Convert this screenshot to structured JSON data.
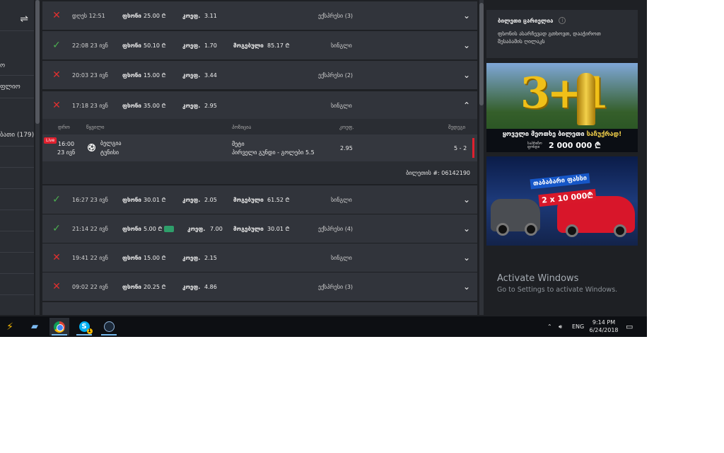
{
  "sidebar": {
    "filter_icon": "sliders-icon",
    "items": [
      {
        "label": "ო"
      },
      {
        "label": "ფლიო"
      },
      {
        "label": "ბათი (179)"
      }
    ]
  },
  "bets": [
    {
      "status": "lost",
      "time": "დღეს 12:51",
      "stake_label": "ფსონი",
      "stake": "25.00 ₾",
      "odds_label": "კოეფ.",
      "odds": "3.11",
      "win_label": "",
      "win": "",
      "type": "ექსპრესი (3)",
      "expanded": false
    },
    {
      "status": "won",
      "time": "22:08 23 ივნ",
      "stake_label": "ფსონი",
      "stake": "50.10 ₾",
      "odds_label": "კოეფ.",
      "odds": "1.70",
      "win_label": "მოგებული",
      "win": "85.17 ₾",
      "type": "სინგლი",
      "expanded": false
    },
    {
      "status": "lost",
      "time": "20:03 23 ივნ",
      "stake_label": "ფსონი",
      "stake": "15.00 ₾",
      "odds_label": "კოეფ.",
      "odds": "3.44",
      "win_label": "",
      "win": "",
      "type": "ექსპრესი (2)",
      "expanded": false
    },
    {
      "status": "lost",
      "time": "17:18 23 ივნ",
      "stake_label": "ფსონი",
      "stake": "35.00 ₾",
      "odds_label": "კოეფ.",
      "odds": "2.95",
      "win_label": "",
      "win": "",
      "type": "სინგლი",
      "expanded": true
    }
  ],
  "details": {
    "headers": {
      "time": "დრო",
      "match": "წყვილი",
      "pick": "პოზიცია",
      "odds": "კოეფ.",
      "result": "შედეგი"
    },
    "live_label": "Live",
    "time": "16:00",
    "date": "23 ივნ",
    "team1": "ბელგია",
    "team2": "ტუნისი",
    "pick_title": "მეტი",
    "pick_desc": "პირველი გუნდი - გოლები 5.5",
    "odds": "2.95",
    "score": "5 - 2",
    "ticket_label": "ბილეთის #: 06142190"
  },
  "bets2": [
    {
      "status": "won",
      "time": "16:27 23 ივნ",
      "stake_label": "ფსონი",
      "stake": "30.01 ₾",
      "odds_label": "კოეფ.",
      "odds": "2.05",
      "win_label": "მოგებული",
      "win": "61.52 ₾",
      "type": "სინგლი"
    },
    {
      "status": "won",
      "time": "21:14 22 ივნ",
      "stake_label": "ფსონი",
      "stake": "5.00 ₾",
      "odds_label": "კოეფ.",
      "odds": "7.00",
      "win_label": "მოგებული",
      "win": "30.01 ₾",
      "type": "ექსპრესი (4)"
    },
    {
      "status": "lost",
      "time": "19:41 22 ივნ",
      "stake_label": "ფსონი",
      "stake": "15.00 ₾",
      "odds_label": "კოეფ.",
      "odds": "2.15",
      "win_label": "",
      "win": "",
      "type": "სინგლი"
    },
    {
      "status": "lost",
      "time": "09:02 22 ივნ",
      "stake_label": "ფსონი",
      "stake": "20.25 ₾",
      "odds_label": "კოეფ.",
      "odds": "4.86",
      "win_label": "",
      "win": "",
      "type": "ექსპრესი (3)"
    }
  ],
  "betslip": {
    "title": "ბილეთი ცარიელია",
    "description": "ფსონის ასარჩევად გთხოვთ, დააჭიროთ შესაბამის ღილაკს"
  },
  "banner1": {
    "big": "3+1",
    "line1_a": "ყოველი მეოთხე ბილეთი ",
    "line1_b": "საჩუქრად!",
    "small": "საპრიზო ფონდი",
    "prize": "2 000 000 ₾"
  },
  "banner2": {
    "t1": "თაბაბარი ფასსი",
    "t2": "2 x 10 000₾"
  },
  "activation": {
    "title": "Activate Windows",
    "subtitle": "Go to Settings to activate Windows."
  },
  "taskbar": {
    "lang": "ENG",
    "time": "9:14 PM",
    "date": "6/24/2018",
    "skype_badge": "1"
  },
  "colors": {
    "lost": "#e0302f",
    "won": "#4caf50",
    "live": "#e0202e",
    "bg": "#1e2024",
    "row": "#31343b"
  }
}
